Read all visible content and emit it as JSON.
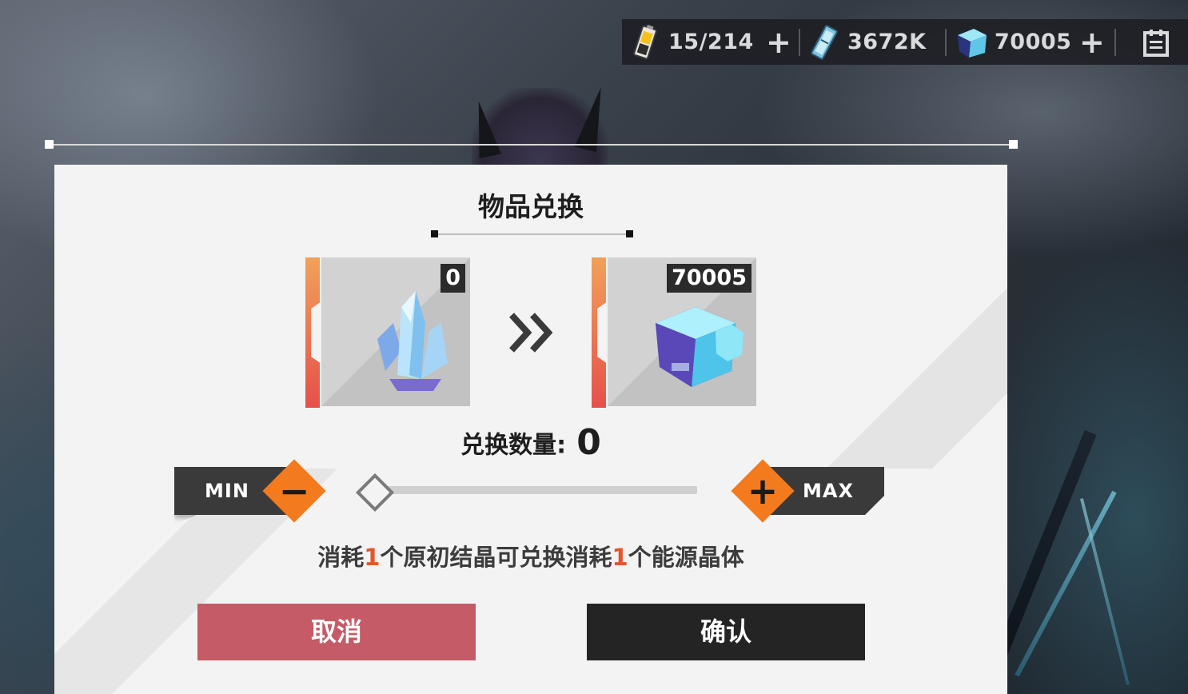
{
  "topbar": {
    "stamina": {
      "value": "15/214",
      "icon": "battery-stamina-icon"
    },
    "currency": {
      "value": "3672K",
      "icon": "ticket-currency-icon"
    },
    "energy_crystal": {
      "value": "70005",
      "icon": "energy-cube-icon"
    },
    "plus_glyph": "+",
    "menu_icon": "task-list-icon"
  },
  "dialog": {
    "title": "物品兑换",
    "source_item": {
      "name": "原初结晶",
      "count": "0",
      "icon": "crystal-cluster-icon"
    },
    "target_item": {
      "name": "能源晶体",
      "count": "70005",
      "icon": "energy-cube-icon"
    },
    "quantity_label": "兑换数量:",
    "quantity_value": "0",
    "slider_fraction": 0,
    "min_label": "MIN",
    "max_label": "MAX",
    "minus_glyph": "−",
    "plus_glyph": "+",
    "description": {
      "part1": "消耗",
      "num1": "1",
      "part2": "个原初结晶可兑换消耗",
      "num2": "1",
      "part3": "个能源晶体"
    },
    "cancel_label": "取消",
    "confirm_label": "确认"
  },
  "colors": {
    "accent_orange": "#f47a1e",
    "cancel_red": "#c45b66",
    "confirm_dark": "#242424",
    "highlight_number": "#e2562e"
  }
}
